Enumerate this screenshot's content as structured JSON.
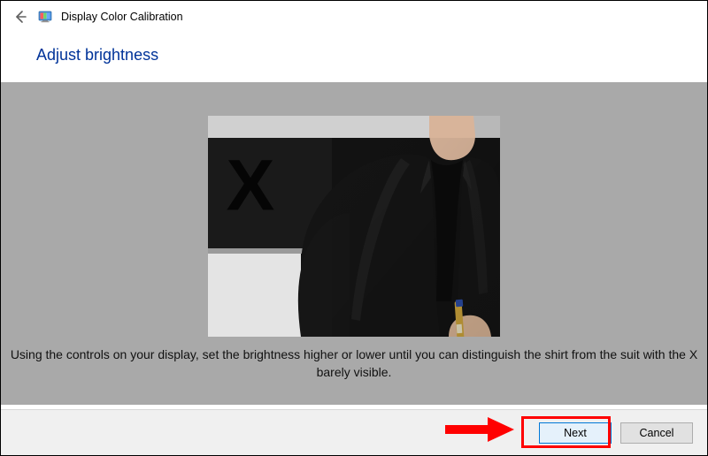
{
  "header": {
    "app_title": "Display Color Calibration"
  },
  "page": {
    "title": "Adjust brightness",
    "instruction": "Using the controls on your display, set the brightness higher or lower until you can distinguish the shirt from the suit with the X barely visible."
  },
  "buttons": {
    "next": "Next",
    "cancel": "Cancel"
  },
  "image": {
    "x_glyph": "X"
  }
}
